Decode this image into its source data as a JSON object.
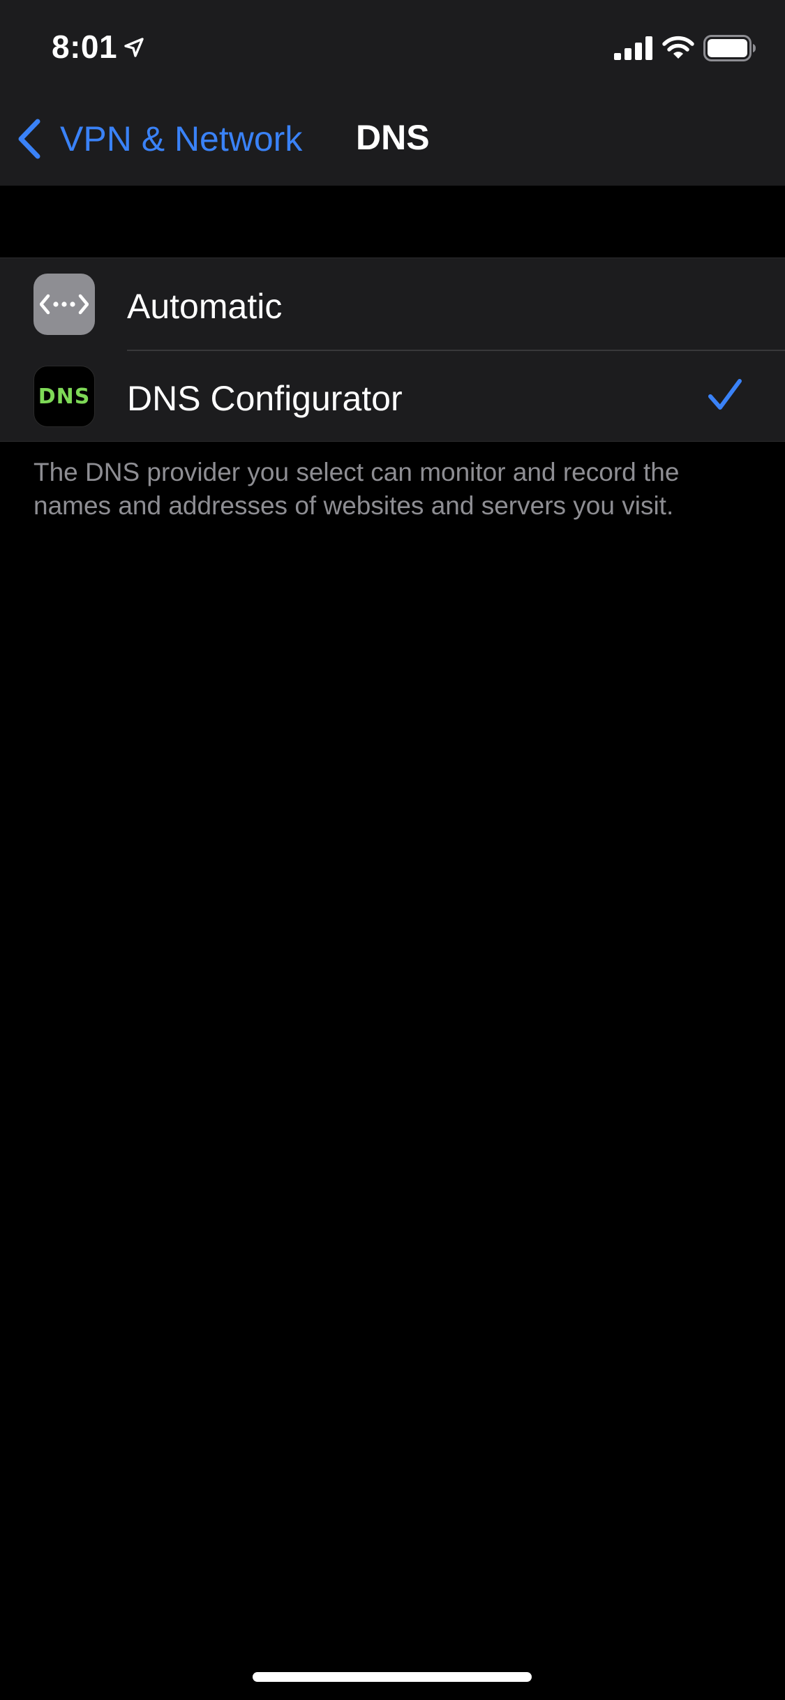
{
  "status_bar": {
    "time": "8:01",
    "icons": [
      "location-arrow-icon",
      "signal-bars-icon",
      "wifi-icon",
      "battery-icon"
    ]
  },
  "nav": {
    "back_label": "VPN & Network",
    "title": "DNS",
    "back_icon": "chevron-left-icon"
  },
  "dns_options": [
    {
      "label": "Automatic",
      "icon": "network-arrows-icon",
      "selected": false
    },
    {
      "label": "DNS Configurator",
      "icon": "dns-app-icon",
      "icon_text": "DNS",
      "selected": true
    }
  ],
  "footer": {
    "text": "The DNS provider you select can monitor and record the names and addresses of websites and servers you visit."
  },
  "colors": {
    "accent": "#3a82f7",
    "background": "#000000",
    "group_background": "#1c1c1e",
    "secondary_text": "#8e8e93",
    "dns_icon_text": "#7ed957"
  }
}
